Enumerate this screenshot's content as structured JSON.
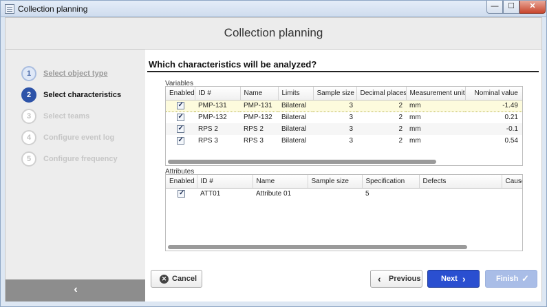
{
  "window": {
    "title": "Collection planning",
    "min_glyph": "—",
    "max_glyph": "☐",
    "close_glyph": "✕"
  },
  "header": {
    "title": "Collection planning"
  },
  "sidebar": {
    "steps": [
      {
        "number": "1",
        "label": "Select object type",
        "state": "done"
      },
      {
        "number": "2",
        "label": "Select characteristics",
        "state": "active"
      },
      {
        "number": "3",
        "label": "Select teams",
        "state": "disabled"
      },
      {
        "number": "4",
        "label": "Configure event log",
        "state": "disabled"
      },
      {
        "number": "5",
        "label": "Configure frequency",
        "state": "disabled"
      }
    ],
    "collapse_glyph": "‹"
  },
  "main": {
    "question": "Which characteristics will be analyzed?",
    "variables": {
      "label": "Variables",
      "columns": [
        "Enabled",
        "ID #",
        "Name",
        "Limits",
        "Sample size",
        "Decimal places",
        "Measurement unit",
        "Nominal value"
      ],
      "rows": [
        {
          "enabled": true,
          "id": "PMP-131",
          "name": "PMP-131",
          "limits": "Bilateral",
          "sample_size": "3",
          "decimal_places": "2",
          "unit": "mm",
          "nominal": "-1.49",
          "selected": true
        },
        {
          "enabled": true,
          "id": "PMP-132",
          "name": "PMP-132",
          "limits": "Bilateral",
          "sample_size": "3",
          "decimal_places": "2",
          "unit": "mm",
          "nominal": "0.21"
        },
        {
          "enabled": true,
          "id": "RPS 2",
          "name": "RPS 2",
          "limits": "Bilateral",
          "sample_size": "3",
          "decimal_places": "2",
          "unit": "mm",
          "nominal": "-0.1"
        },
        {
          "enabled": true,
          "id": "RPS 3",
          "name": "RPS 3",
          "limits": "Bilateral",
          "sample_size": "3",
          "decimal_places": "2",
          "unit": "mm",
          "nominal": "0.54"
        }
      ]
    },
    "attributes": {
      "label": "Attributes",
      "columns": [
        "Enabled",
        "ID #",
        "Name",
        "Sample size",
        "Specification",
        "Defects",
        "Cause"
      ],
      "rows": [
        {
          "enabled": true,
          "id": "ATT01",
          "name": "Attribute 01",
          "sample_size": "",
          "specification": "5",
          "defects": "",
          "cause": ""
        }
      ]
    }
  },
  "footer": {
    "cancel_label": "Cancel",
    "cancel_icon": "✕",
    "previous_label": "Previous",
    "previous_icon": "‹",
    "next_label": "Next",
    "next_icon": "›",
    "finish_label": "Finish",
    "finish_icon": "✓"
  }
}
